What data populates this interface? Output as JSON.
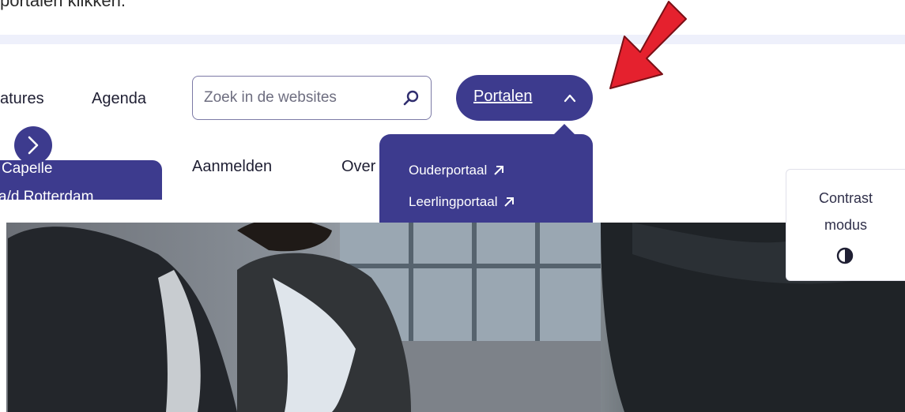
{
  "instruction_text": "portalen klikken.",
  "nav": {
    "items": [
      "atures",
      "Agenda"
    ],
    "search_placeholder": "Zoek in de websites",
    "portalen_label": "Portalen",
    "second_row": [
      "Aanmelden",
      "Over"
    ]
  },
  "dropdown": {
    "items": [
      {
        "label": "Ouderportaal"
      },
      {
        "label": "Leerlingportaal"
      }
    ]
  },
  "side_card": {
    "line1": "Capelle",
    "line2": "a/d Rotterdam"
  },
  "contrast": {
    "line1": "Contrast",
    "line2": "modus"
  },
  "icons": {
    "search": "search-icon",
    "chevron_up": "chevron-up-icon",
    "external": "external-link-icon",
    "next": "chevron-right-icon",
    "contrast": "contrast-icon",
    "annotation_arrow": "red-arrow-icon"
  },
  "colors": {
    "brand": "#3d3b8e",
    "annotation": "#e5212e",
    "topline": "#eef0fb"
  }
}
